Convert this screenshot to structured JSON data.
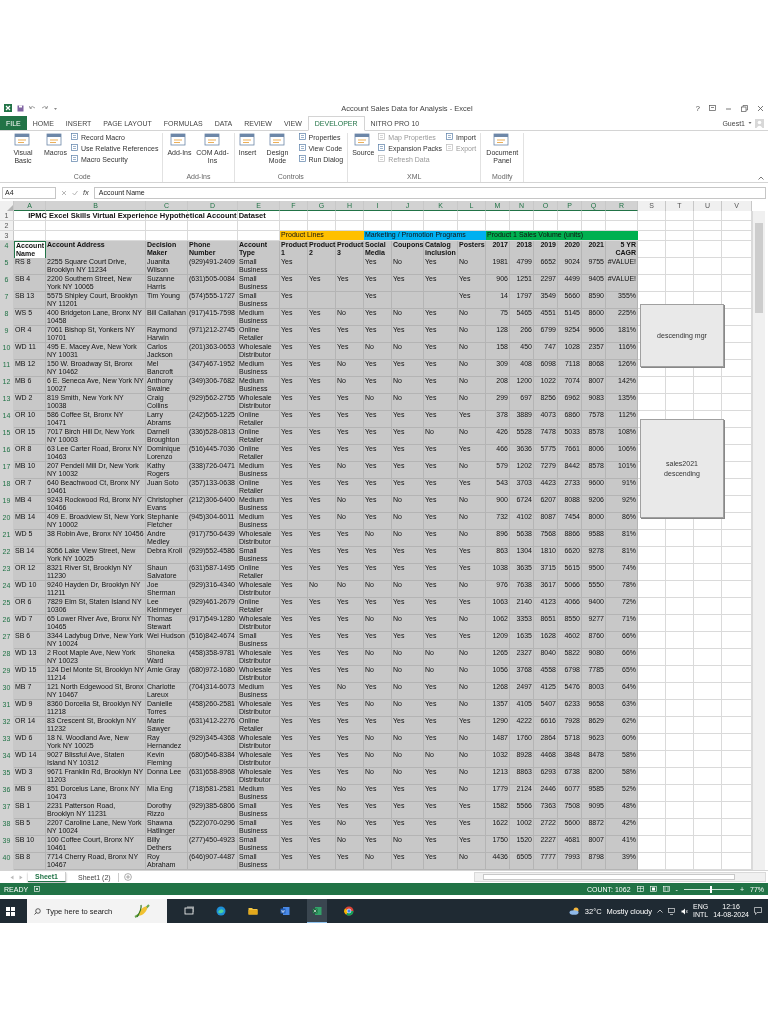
{
  "window": {
    "title": "Account Sales Data for Analysis - Excel",
    "help": "?",
    "user": "Guest1"
  },
  "ribbon_tabs": [
    {
      "label": "FILE",
      "kind": "file",
      "selected": false
    },
    {
      "label": "HOME",
      "kind": "tab",
      "selected": false
    },
    {
      "label": "INSERT",
      "kind": "tab",
      "selected": false
    },
    {
      "label": "PAGE LAYOUT",
      "kind": "tab",
      "selected": false
    },
    {
      "label": "FORMULAS",
      "kind": "tab",
      "selected": false
    },
    {
      "label": "DATA",
      "kind": "tab",
      "selected": false
    },
    {
      "label": "REVIEW",
      "kind": "tab",
      "selected": false
    },
    {
      "label": "VIEW",
      "kind": "tab",
      "selected": false
    },
    {
      "label": "DEVELOPER",
      "kind": "tab",
      "selected": true
    },
    {
      "label": "NITRO PRO 10",
      "kind": "tab",
      "selected": false
    }
  ],
  "ribbon_groups": [
    {
      "label": "Code",
      "commands": [
        {
          "label": "Visual Basic",
          "kind": "large",
          "disabled": false
        },
        {
          "label": "Macros",
          "kind": "large",
          "disabled": false
        },
        {
          "label": "Record Macro",
          "kind": "small",
          "disabled": false
        },
        {
          "label": "Use Relative References",
          "kind": "small",
          "disabled": false
        },
        {
          "label": "Macro Security",
          "kind": "small",
          "disabled": false
        }
      ]
    },
    {
      "label": "Add-Ins",
      "commands": [
        {
          "label": "Add-Ins",
          "kind": "large",
          "disabled": false
        },
        {
          "label": "COM Add-Ins",
          "kind": "large",
          "disabled": false
        }
      ]
    },
    {
      "label": "Controls",
      "commands": [
        {
          "label": "Insert",
          "kind": "large",
          "disabled": false
        },
        {
          "label": "Design Mode",
          "kind": "large",
          "disabled": false
        },
        {
          "label": "Properties",
          "kind": "small",
          "disabled": false
        },
        {
          "label": "View Code",
          "kind": "small",
          "disabled": false
        },
        {
          "label": "Run Dialog",
          "kind": "small",
          "disabled": false
        }
      ]
    },
    {
      "label": "XML",
      "commands": [
        {
          "label": "Source",
          "kind": "large",
          "disabled": false
        },
        {
          "label": "Map Properties",
          "kind": "small",
          "disabled": true
        },
        {
          "label": "Expansion Packs",
          "kind": "small",
          "disabled": false
        },
        {
          "label": "Refresh Data",
          "kind": "small",
          "disabled": true
        },
        {
          "label": "Import",
          "kind": "small",
          "disabled": false
        },
        {
          "label": "Export",
          "kind": "small",
          "disabled": true
        }
      ]
    },
    {
      "label": "Modify",
      "commands": [
        {
          "label": "Document Panel",
          "kind": "large",
          "disabled": false
        }
      ]
    }
  ],
  "formula_bar": {
    "name_box": "A4",
    "function_label": "fx",
    "formula": "Account Name"
  },
  "sheet": {
    "columns": [
      {
        "letter": "A",
        "selected": true
      },
      {
        "letter": "B",
        "selected": true
      },
      {
        "letter": "C",
        "selected": true
      },
      {
        "letter": "D",
        "selected": true
      },
      {
        "letter": "E",
        "selected": true
      },
      {
        "letter": "F",
        "selected": true
      },
      {
        "letter": "G",
        "selected": true
      },
      {
        "letter": "H",
        "selected": true
      },
      {
        "letter": "I",
        "selected": true
      },
      {
        "letter": "J",
        "selected": true
      },
      {
        "letter": "K",
        "selected": true
      },
      {
        "letter": "L",
        "selected": true
      },
      {
        "letter": "M",
        "selected": true
      },
      {
        "letter": "N",
        "selected": true
      },
      {
        "letter": "O",
        "selected": true
      },
      {
        "letter": "P",
        "selected": true
      },
      {
        "letter": "Q",
        "selected": true
      },
      {
        "letter": "R",
        "selected": true
      },
      {
        "letter": "S",
        "selected": false
      },
      {
        "letter": "T",
        "selected": false
      },
      {
        "letter": "U",
        "selected": false
      },
      {
        "letter": "V",
        "selected": false
      }
    ],
    "rows": [
      {
        "number": "1",
        "selected": false,
        "kind": "title",
        "cells": [
          "IPMC Excel Skills Virtual Experience Hypothetical Account Dataset"
        ]
      },
      {
        "number": "2",
        "selected": false
      },
      {
        "number": "3",
        "selected": false,
        "cells": [
          null,
          null,
          null,
          null,
          null,
          {
            "text": "Product Lines",
            "color": "#ffc000"
          },
          {
            "color": "#ffc000"
          },
          {
            "color": "#ffc000"
          },
          {
            "text": "Marketing / Promotion Programs",
            "color": "#00b0f0"
          },
          {
            "color": "#00b0f0"
          },
          {
            "color": "#00b0f0"
          },
          {
            "color": "#00b0f0"
          },
          {
            "text": "Product 1 Sales Volume (units)",
            "color": "#00b050"
          },
          {
            "color": "#00b050"
          },
          {
            "color": "#00b050"
          },
          {
            "color": "#00b050"
          },
          {
            "color": "#00b050"
          },
          {
            "color": "#00b050"
          }
        ]
      },
      {
        "number": "4",
        "selected": true,
        "kind": "header",
        "cells": [
          "Account Name",
          "Account Address",
          "Decision Maker",
          "Phone Number",
          "Account Type",
          "Product 1",
          "Product 2",
          "Product 3",
          "Social Media",
          "Coupons",
          "Catalog inclusion",
          "Posters",
          "2017",
          "2018",
          "2019",
          "2020",
          "2021",
          "5 YR CAGR"
        ]
      },
      {
        "number": "5",
        "selected": true,
        "cells": [
          "RS 8",
          "2255 Square Court Drive, Brooklyn NY 11234",
          "Juanita Wilson",
          "(929)491-2409",
          "Small Business",
          "Yes",
          null,
          null,
          "Yes",
          "No",
          "Yes",
          "No",
          "1981",
          "4799",
          "6652",
          "9024",
          "9755",
          "#VALUE!"
        ]
      },
      {
        "number": "6",
        "selected": true,
        "cells": [
          "SB 4",
          "2200 Southern Street, New York NY 10065",
          "Suzanne Harris",
          "(631)505-0084",
          "Small Business",
          "Yes",
          "Yes",
          "Yes",
          "Yes",
          "Yes",
          "Yes",
          "Yes",
          "906",
          "1251",
          "2297",
          "4499",
          "9405",
          "#VALUE!"
        ]
      },
      {
        "number": "7",
        "selected": true,
        "cells": [
          "SB 13",
          "5575 Shipley Court, Brooklyn NY 11201",
          "Tim Young",
          "(574)555-1727",
          "Small Business",
          "Yes",
          null,
          null,
          "Yes",
          null,
          null,
          "Yes",
          "14",
          "1797",
          "3549",
          "5660",
          "8590",
          "355%"
        ]
      },
      {
        "number": "8",
        "selected": true,
        "cells": [
          "WS 5",
          "400 Bridgeton Lane, Bronx NY 10458",
          "Bill Callahan",
          "(917)415-7598",
          "Medium Business",
          "Yes",
          "Yes",
          "No",
          "Yes",
          "No",
          "Yes",
          "No",
          "75",
          "5465",
          "4551",
          "5145",
          "8600",
          "225%"
        ]
      },
      {
        "number": "9",
        "selected": true,
        "cells": [
          "OR 4",
          "7061 Bishop St, Yonkers NY 10701",
          "Raymond Harwin",
          "(971)212-2745",
          "Online Retailer",
          "Yes",
          "Yes",
          "Yes",
          "Yes",
          "Yes",
          "Yes",
          "No",
          "128",
          "266",
          "6799",
          "9254",
          "9606",
          "181%"
        ]
      },
      {
        "number": "10",
        "selected": true,
        "cells": [
          "WD 11",
          "495 E. Macey Ave, New York NY 10031",
          "Carlos Jackson",
          "(201)363-0653",
          "Wholesale Distributor",
          "Yes",
          "Yes",
          "Yes",
          "No",
          "No",
          "Yes",
          "No",
          "158",
          "450",
          "747",
          "1028",
          "2357",
          "116%"
        ]
      },
      {
        "number": "11",
        "selected": true,
        "cells": [
          "MB 12",
          "150 W. Broadway St, Bronx NY 10462",
          "Mel Bancroft",
          "(347)467-1952",
          "Medium Business",
          "Yes",
          "Yes",
          "No",
          "Yes",
          "Yes",
          "Yes",
          "No",
          "309",
          "408",
          "6098",
          "7118",
          "8068",
          "126%"
        ]
      },
      {
        "number": "12",
        "selected": true,
        "cells": [
          "MB 6",
          "6 E. Seneca Ave, New York NY 10027",
          "Anthony Swaine",
          "(349)306-7682",
          "Medium Business",
          "Yes",
          "Yes",
          "No",
          "Yes",
          "No",
          "Yes",
          "No",
          "208",
          "1200",
          "1022",
          "7074",
          "8007",
          "142%"
        ]
      },
      {
        "number": "13",
        "selected": true,
        "cells": [
          "WD 2",
          "819 Smith, New York NY 10038",
          "Craig Collins",
          "(929)562-2755",
          "Wholesale Distributor",
          "Yes",
          "Yes",
          "Yes",
          "No",
          "No",
          "Yes",
          "No",
          "299",
          "697",
          "8256",
          "6962",
          "9083",
          "135%"
        ]
      },
      {
        "number": "14",
        "selected": true,
        "cells": [
          "OR 10",
          "586 Coffee St, Bronx NY 10471",
          "Larry Abrams",
          "(242)565-1225",
          "Online Retailer",
          "Yes",
          "Yes",
          "Yes",
          "Yes",
          "Yes",
          "Yes",
          "Yes",
          "378",
          "3889",
          "4073",
          "6860",
          "7578",
          "112%"
        ]
      },
      {
        "number": "15",
        "selected": true,
        "cells": [
          "OR 15",
          "7017 Birch Hill Dr, New York NY 10003",
          "Darnell Broughton",
          "(336)528-0813",
          "Online Retailer",
          "Yes",
          "Yes",
          "Yes",
          "Yes",
          "Yes",
          "No",
          "No",
          "426",
          "5528",
          "7478",
          "5033",
          "8578",
          "108%"
        ]
      },
      {
        "number": "16",
        "selected": true,
        "cells": [
          "OR 8",
          "63 Lee Carter Road, Bronx NY 10463",
          "Dominique Lorenzo",
          "(516)445-7036",
          "Online Retailer",
          "Yes",
          "Yes",
          "Yes",
          "Yes",
          "Yes",
          "Yes",
          "Yes",
          "466",
          "3636",
          "5775",
          "7661",
          "8006",
          "106%"
        ]
      },
      {
        "number": "17",
        "selected": true,
        "cells": [
          "MB 10",
          "207 Pendell Mill Dr, New York NY 10032",
          "Kathy Rogers",
          "(338)726-0471",
          "Medium Business",
          "Yes",
          "Yes",
          "No",
          "Yes",
          "Yes",
          "Yes",
          "No",
          "579",
          "1202",
          "7279",
          "8442",
          "8578",
          "101%"
        ]
      },
      {
        "number": "18",
        "selected": true,
        "cells": [
          "OR 7",
          "640 Beachwood Ct, Bronx NY 10461",
          "Juan Soto",
          "(357)133-0638",
          "Online Retailer",
          "Yes",
          "Yes",
          "Yes",
          "Yes",
          "Yes",
          "Yes",
          "Yes",
          "543",
          "3703",
          "4423",
          "2733",
          "9600",
          "91%"
        ]
      },
      {
        "number": "19",
        "selected": true,
        "cells": [
          "MB 4",
          "9243 Rockwood Rd, Bronx NY 10466",
          "Christopher Evans",
          "(212)306-6400",
          "Medium Business",
          "Yes",
          "Yes",
          "No",
          "Yes",
          "No",
          "Yes",
          "No",
          "900",
          "6724",
          "6207",
          "8088",
          "9206",
          "92%"
        ]
      },
      {
        "number": "20",
        "selected": true,
        "cells": [
          "MB 14",
          "409 E. Broadview St, New York NY 10002",
          "Stephanie Fletcher",
          "(945)304-6011",
          "Medium Business",
          "Yes",
          "Yes",
          "No",
          "Yes",
          "No",
          "Yes",
          "No",
          "732",
          "4102",
          "8087",
          "7454",
          "8000",
          "86%"
        ]
      },
      {
        "number": "21",
        "selected": true,
        "cells": [
          "WD 5",
          "38 Robin Ave, Bronx NY 10456",
          "Andre Medley",
          "(917)750-6439",
          "Wholesale Distributor",
          "Yes",
          "Yes",
          "Yes",
          "No",
          "No",
          "Yes",
          "No",
          "896",
          "5638",
          "7568",
          "8866",
          "9588",
          "81%"
        ]
      },
      {
        "number": "22",
        "selected": true,
        "cells": [
          "SB 14",
          "8056 Lake View Street, New York NY 10025",
          "Debra Kroll",
          "(929)552-4586",
          "Small Business",
          "Yes",
          "Yes",
          "Yes",
          "Yes",
          "Yes",
          "Yes",
          "Yes",
          "863",
          "1304",
          "1810",
          "6620",
          "9278",
          "81%"
        ]
      },
      {
        "number": "23",
        "selected": true,
        "cells": [
          "OR 12",
          "8321 River St, Brooklyn NY 11230",
          "Shaun Salvatore",
          "(631)587-1495",
          "Online Retailer",
          "Yes",
          "Yes",
          "Yes",
          "Yes",
          "Yes",
          "Yes",
          "Yes",
          "1038",
          "3635",
          "3715",
          "5615",
          "9500",
          "74%"
        ]
      },
      {
        "number": "24",
        "selected": true,
        "cells": [
          "WD 10",
          "9240 Hayden Dr, Brooklyn NY 11211",
          "Joe Sherman",
          "(929)316-4340",
          "Wholesale Distributor",
          "Yes",
          "No",
          "No",
          "No",
          "No",
          "Yes",
          "No",
          "976",
          "7638",
          "3617",
          "5066",
          "5550",
          "78%"
        ]
      },
      {
        "number": "25",
        "selected": true,
        "cells": [
          "OR 6",
          "7829 Elm St, Staten Island NY 10306",
          "Lee Kleinmeyer",
          "(929)461-2679",
          "Online Retailer",
          "Yes",
          "Yes",
          "Yes",
          "Yes",
          "Yes",
          "Yes",
          "Yes",
          "1063",
          "2140",
          "4123",
          "4066",
          "9400",
          "72%"
        ]
      },
      {
        "number": "26",
        "selected": true,
        "cells": [
          "WD 7",
          "65 Lower River Ave, Bronx NY 10465",
          "Thomas Stewart",
          "(917)549-1280",
          "Wholesale Distributor",
          "Yes",
          "Yes",
          "Yes",
          "No",
          "No",
          "Yes",
          "No",
          "1062",
          "3353",
          "8651",
          "8550",
          "9277",
          "71%"
        ]
      },
      {
        "number": "27",
        "selected": true,
        "cells": [
          "SB 6",
          "3344 Ladybug Drive, New York NY 10024",
          "Wei Hudson",
          "(516)842-4674",
          "Small Business",
          "Yes",
          "Yes",
          "Yes",
          "Yes",
          "Yes",
          "Yes",
          "Yes",
          "1209",
          "1635",
          "1628",
          "4602",
          "8760",
          "66%"
        ]
      },
      {
        "number": "28",
        "selected": true,
        "cells": [
          "WD 13",
          "2 Root Maple Ave, New York NY 10023",
          "Shoneka Ward",
          "(458)358-9781",
          "Wholesale Distributor",
          "Yes",
          "Yes",
          "Yes",
          "No",
          "No",
          "No",
          "No",
          "1265",
          "2327",
          "8040",
          "5822",
          "9080",
          "66%"
        ]
      },
      {
        "number": "29",
        "selected": true,
        "cells": [
          "WD 15",
          "124 Del Monte St, Brooklyn NY 11214",
          "Amie Gray",
          "(680)972-1680",
          "Wholesale Distributor",
          "Yes",
          "Yes",
          "Yes",
          "No",
          "No",
          "No",
          "No",
          "1056",
          "3768",
          "4558",
          "6798",
          "7785",
          "65%"
        ]
      },
      {
        "number": "30",
        "selected": true,
        "cells": [
          "MB 7",
          "121 North Edgewood St, Bronx NY 10467",
          "Charlotte Lareux",
          "(704)314-6073",
          "Medium Business",
          "Yes",
          "Yes",
          "No",
          "Yes",
          "No",
          "Yes",
          "No",
          "1268",
          "2497",
          "4125",
          "5476",
          "8003",
          "64%"
        ]
      },
      {
        "number": "31",
        "selected": true,
        "cells": [
          "WD 9",
          "8360 Dorcelia St, Brooklyn NY 11218",
          "Danielle Torres",
          "(458)260-2581",
          "Wholesale Distributor",
          "Yes",
          "Yes",
          "Yes",
          "No",
          "No",
          "Yes",
          "No",
          "1357",
          "4105",
          "5407",
          "6233",
          "9658",
          "63%"
        ]
      },
      {
        "number": "32",
        "selected": true,
        "cells": [
          "OR 14",
          "83 Crescent St, Brooklyn NY 11232",
          "Marie Sawyer",
          "(631)412-2276",
          "Online Retailer",
          "Yes",
          "Yes",
          "Yes",
          "Yes",
          "Yes",
          "Yes",
          "Yes",
          "1290",
          "4222",
          "6616",
          "7928",
          "8629",
          "62%"
        ]
      },
      {
        "number": "33",
        "selected": true,
        "cells": [
          "WD 6",
          "18 N. Woodland Ave, New York NY 10025",
          "Ray Hernandez",
          "(929)345-4368",
          "Wholesale Distributor",
          "Yes",
          "Yes",
          "Yes",
          "No",
          "No",
          "Yes",
          "No",
          "1487",
          "1760",
          "2864",
          "5718",
          "9623",
          "60%"
        ]
      },
      {
        "number": "34",
        "selected": true,
        "cells": [
          "WD 14",
          "9027 Blissful Ave, Staten Island NY 10312",
          "Kevin Fleming",
          "(680)546-8384",
          "Wholesale Distributor",
          "Yes",
          "Yes",
          "Yes",
          "No",
          "No",
          "No",
          "No",
          "1032",
          "8928",
          "4468",
          "3848",
          "8478",
          "58%"
        ]
      },
      {
        "number": "35",
        "selected": true,
        "cells": [
          "WD 3",
          "9671 Franklin Rd, Brooklyn NY 11203",
          "Donna Lee",
          "(631)658-8968",
          "Wholesale Distributor",
          "Yes",
          "Yes",
          "Yes",
          "No",
          "No",
          "Yes",
          "No",
          "1213",
          "8863",
          "6293",
          "6738",
          "8200",
          "58%"
        ]
      },
      {
        "number": "36",
        "selected": true,
        "cells": [
          "MB 9",
          "851 Dorcelus Lane, Bronx NY 10473",
          "Mia Eng",
          "(718)581-2581",
          "Medium Business",
          "Yes",
          "Yes",
          "No",
          "Yes",
          "Yes",
          "Yes",
          "No",
          "1779",
          "2124",
          "2446",
          "6077",
          "9585",
          "52%"
        ]
      },
      {
        "number": "37",
        "selected": true,
        "cells": [
          "SB 1",
          "2231 Patterson Road, Brooklyn NY 11231",
          "Dorothy Rizzo",
          "(929)385-6806",
          "Small Business",
          "Yes",
          "Yes",
          "Yes",
          "Yes",
          "Yes",
          "Yes",
          "Yes",
          "1582",
          "5566",
          "7363",
          "7508",
          "9095",
          "48%"
        ]
      },
      {
        "number": "38",
        "selected": true,
        "cells": [
          "SB 5",
          "2207 Caroline Lane, New York NY 10024",
          "Shawna Hatlinger",
          "(522)070-0296",
          "Small Business",
          "Yes",
          "Yes",
          "No",
          "Yes",
          "Yes",
          "Yes",
          "Yes",
          "1622",
          "1002",
          "2722",
          "5600",
          "8872",
          "42%"
        ]
      },
      {
        "number": "39",
        "selected": true,
        "cells": [
          "SB 10",
          "100 Coffee Court, Bronx NY 10461",
          "Billy Dethers",
          "(277)450-4923",
          "Small Business",
          "Yes",
          "Yes",
          "No",
          "Yes",
          "No",
          "Yes",
          "Yes",
          "1750",
          "1520",
          "2227",
          "4681",
          "8007",
          "41%"
        ]
      },
      {
        "number": "40",
        "selected": true,
        "cells": [
          "SB 8",
          "7714 Cherry Road, Bronx NY 10467",
          "Roy Abraham",
          "(646)907-4487",
          "Small Business",
          "Yes",
          "Yes",
          "Yes",
          "No",
          "Yes",
          "Yes",
          "No",
          "4436",
          "6505",
          "7777",
          "7993",
          "8798",
          "39%"
        ]
      }
    ],
    "buttons": [
      {
        "label": "descending mgr"
      },
      {
        "label": "sales2021 descending"
      }
    ]
  },
  "sheet_tabs": [
    {
      "label": "Sheet1",
      "selected": true
    },
    {
      "label": "Sheet1 (2)",
      "selected": false
    }
  ],
  "status_bar": {
    "mode": "READY",
    "count": "COUNT: 1062",
    "zoom_out": "-",
    "zoom_in": "+",
    "zoom": {
      "level": 0.52
    },
    "zoom_label": "77%"
  },
  "taskbar": {
    "search": {
      "placeholder": "Type here to search"
    },
    "apps": [
      {
        "kind": "taskview",
        "active": false
      },
      {
        "kind": "browser",
        "active": false
      },
      {
        "kind": "folder",
        "active": false
      },
      {
        "kind": "document",
        "active": false
      },
      {
        "kind": "spreadsheet",
        "active": true
      },
      {
        "kind": "round-browser",
        "active": false
      }
    ],
    "temperature": "32°C",
    "weather": "Mostly cloudy",
    "language": "ENG",
    "layout": "INTL",
    "time": "12:16",
    "date": "14-08-2024"
  }
}
